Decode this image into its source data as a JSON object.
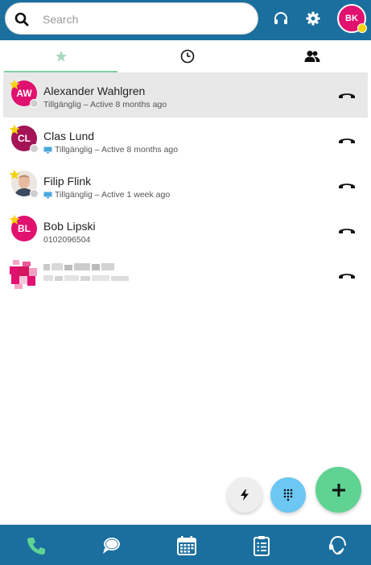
{
  "header": {
    "search_placeholder": "Search",
    "user_initials": "BK",
    "status_color": "#f5d20c",
    "icons": [
      "search-icon",
      "headset-icon",
      "gear-icon"
    ]
  },
  "tabs": [
    {
      "id": "favorites",
      "icon": "star-icon",
      "active": true
    },
    {
      "id": "recent",
      "icon": "clock-icon",
      "active": false
    },
    {
      "id": "contacts",
      "icon": "people-icon",
      "active": false
    }
  ],
  "contacts": [
    {
      "initials": "AW",
      "name": "Alexander Wahlgren",
      "status": "Tillgänglig – Active 8 months ago",
      "avatar_color": "#e0116f",
      "favorite": true,
      "selected": true,
      "desktop": false
    },
    {
      "initials": "CL",
      "name": "Clas Lund",
      "status": "Tillgänglig – Active 8 months ago",
      "avatar_color": "#a51457",
      "favorite": true,
      "selected": false,
      "desktop": true
    },
    {
      "initials": "",
      "name": "Filip Flink",
      "status": "Tillgänglig – Active 1 week ago",
      "avatar_color": "#e7e1dc",
      "favorite": true,
      "selected": false,
      "desktop": true,
      "photo": true
    },
    {
      "initials": "BL",
      "name": "Bob Lipski",
      "status": "0102096504",
      "avatar_color": "#e0116f",
      "favorite": true,
      "selected": false,
      "desktop": false
    },
    {
      "initials": "",
      "name": "",
      "status": "",
      "avatar_color": "#e0116f",
      "favorite": false,
      "selected": false,
      "desktop": false,
      "blurred": true
    }
  ],
  "fabs": [
    "lightning-icon",
    "dialpad-icon",
    "plus-icon"
  ],
  "colors": {
    "brand": "#1b6f9e",
    "accent_green": "#5fd392",
    "accent_blue": "#6cc7f3",
    "magenta": "#e0116f"
  },
  "bottom_nav": [
    "phone-icon",
    "chat-icon",
    "calendar-icon",
    "clipboard-icon",
    "support-icon"
  ]
}
